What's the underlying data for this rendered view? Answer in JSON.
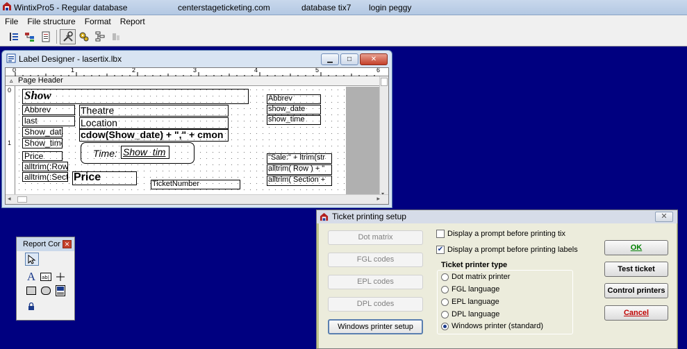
{
  "app": {
    "title": "WintixPro5 - Regular database",
    "site": "centerstageticketing.com",
    "database": "database tix7",
    "login": "login peggy"
  },
  "menu": [
    "File",
    "File structure",
    "Format",
    "Report"
  ],
  "toolbar": {
    "icons": [
      "list-icon",
      "tree-icon",
      "document-icon",
      "tools-icon",
      "gears-icon",
      "flowchart-icon",
      "disabled-tool-icon"
    ]
  },
  "label_designer": {
    "title": "Label Designer - lasertix.lbx",
    "band": "Page Header",
    "ruler_numbers": [
      "1",
      "2",
      "3",
      "4",
      "5",
      "6"
    ],
    "ruler_v_numbers": [
      "0",
      "1"
    ],
    "fields": {
      "show": "Show",
      "abbrev_left": "Abbrev",
      "last": "last",
      "show_date_left": "Show_date",
      "show_time_left": "Show_time",
      "price_small": "Price",
      "alltrim_row_left": "alltrim(:Row",
      "alltrim_sect_left": "alltrim(:Sect",
      "theatre": "Theatre",
      "location": "Location",
      "cdow": "cdow(Show_date) + \",\" + cmon",
      "time_label": "Time:",
      "time_field": "Show_tim",
      "price_big": "Price",
      "ticket_number": "TicketNumber",
      "abbrev_right": "Abbrev",
      "show_date_right": "show_date",
      "show_time_right": "show_time",
      "sale": "\"Sale:\" + ltrim(str",
      "alltrim_row_right": "alltrim( Row ) + \"",
      "alltrim_section_right": "alltrim( Section +"
    }
  },
  "report_controls": {
    "title": "Report Cor"
  },
  "ticket_setup": {
    "title": "Ticket printing setup",
    "buttons": {
      "dot_matrix": "Dot matrix",
      "fgl_codes": "FGL codes",
      "epl_codes": "EPL codes",
      "dpl_codes": "DPL codes",
      "windows_printer_setup": "Windows printer setup"
    },
    "checkboxes": {
      "prompt_tix": "Display a prompt before printing tix",
      "prompt_labels": "Display a prompt before printing labels"
    },
    "group_label": "Ticket printer type",
    "printer_types": [
      "Dot matrix printer",
      "FGL language",
      "EPL language",
      "DPL language",
      "Windows printer (standard)"
    ],
    "selected_printer": "Windows printer (standard)",
    "actions": {
      "ok": "OK",
      "test_ticket": "Test ticket",
      "control_printers": "Control printers",
      "cancel": "Cancel"
    },
    "colors": {
      "cancel_text": "#c00000",
      "ok_text": "#008000"
    }
  }
}
